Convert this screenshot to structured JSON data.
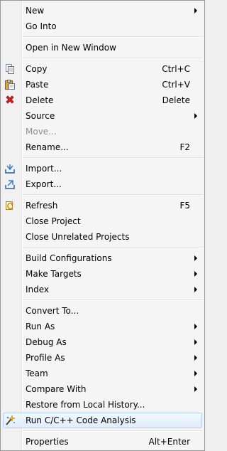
{
  "menu": {
    "new": "New",
    "go_into": "Go Into",
    "open_new_window": "Open in New Window",
    "copy": "Copy",
    "copy_shortcut": "Ctrl+C",
    "paste": "Paste",
    "paste_shortcut": "Ctrl+V",
    "delete": "Delete",
    "delete_shortcut": "Delete",
    "source": "Source",
    "move": "Move...",
    "rename": "Rename...",
    "rename_shortcut": "F2",
    "import": "Import...",
    "export": "Export...",
    "refresh": "Refresh",
    "refresh_shortcut": "F5",
    "close_project": "Close Project",
    "close_unrelated": "Close Unrelated Projects",
    "build_configurations": "Build Configurations",
    "make_targets": "Make Targets",
    "index": "Index",
    "convert_to": "Convert To...",
    "run_as": "Run As",
    "debug_as": "Debug As",
    "profile_as": "Profile As",
    "team": "Team",
    "compare_with": "Compare With",
    "restore_history": "Restore from Local History...",
    "run_code_analysis": "Run C/C++ Code Analysis",
    "properties": "Properties",
    "properties_shortcut": "Alt+Enter"
  },
  "colors": {
    "highlight_border": "#aecff7",
    "disabled_text": "#8d8d8d"
  }
}
